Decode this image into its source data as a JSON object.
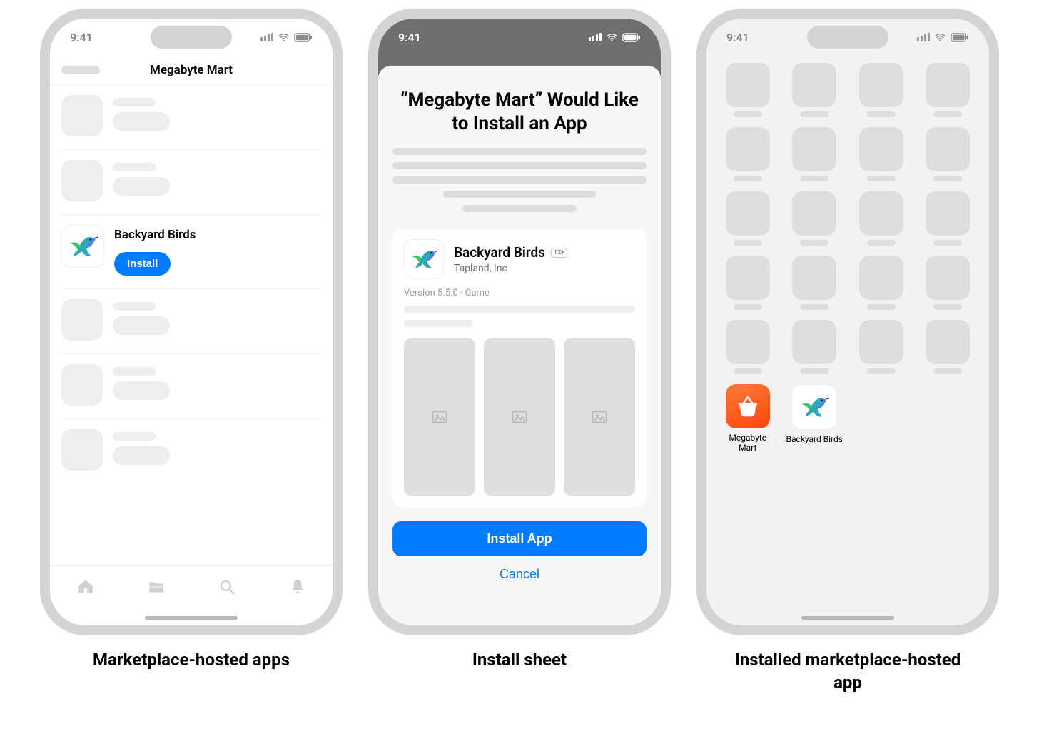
{
  "status": {
    "time": "9:41"
  },
  "screen1": {
    "nav_title": "Megabyte Mart",
    "app_name": "Backyard Birds",
    "install_label": "Install"
  },
  "screen2": {
    "sheet_title": "“Megabyte Mart” Would Like to Install an App",
    "app_name": "Backyard Birds",
    "age_rating": "12+",
    "developer": "Tapland, Inc",
    "version_line": "Version 5.5.0 · Game",
    "install_label": "Install App",
    "cancel_label": "Cancel"
  },
  "screen3": {
    "app1_label": "Megabyte Mart",
    "app2_label": "Backyard Birds"
  },
  "captions": {
    "c1": "Marketplace-hosted apps",
    "c2": "Install sheet",
    "c3": "Installed marketplace-hosted app"
  }
}
